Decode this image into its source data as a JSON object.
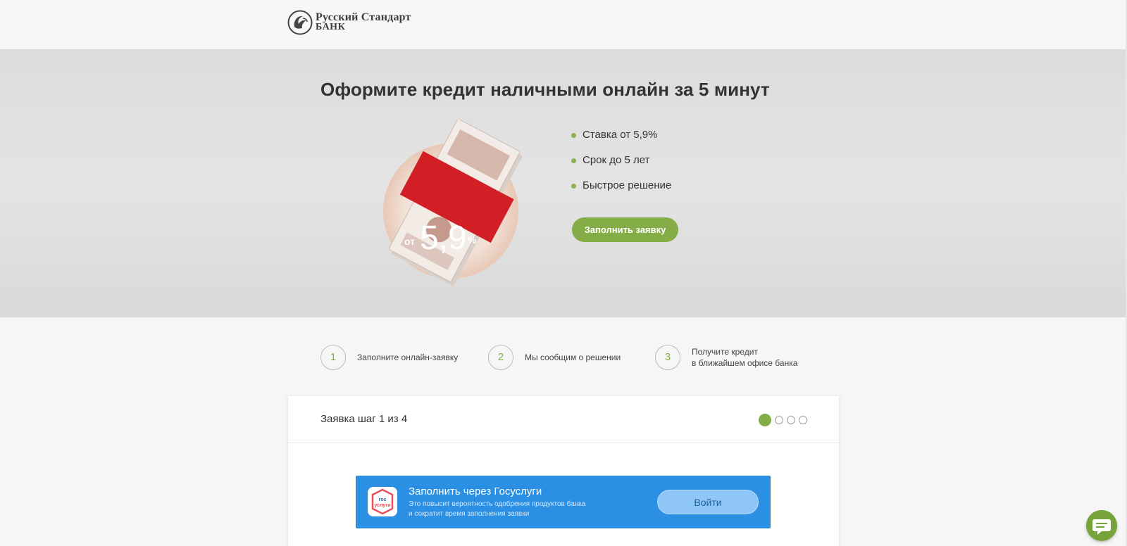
{
  "header": {
    "logo": {
      "line1": "Русский Стандарт",
      "line2": "БАНК"
    }
  },
  "hero": {
    "title": "Оформите кредит наличными онлайн за 5 минут",
    "art": {
      "rate_prefix": "от",
      "rate_value": "5,9",
      "rate_unit": "%"
    },
    "features": [
      "Ставка от 5,9%",
      "Срок до 5 лет",
      "Быстрое решение"
    ],
    "cta_label": "Заполнить заявку",
    "accent_color": "#84ad48"
  },
  "steps": [
    {
      "number": "1",
      "text_line1": "Заполните онлайн-заявку",
      "text_line2": ""
    },
    {
      "number": "2",
      "text_line1": "Мы сообщим о решении",
      "text_line2": ""
    },
    {
      "number": "3",
      "text_line1": "Получите кредит",
      "text_line2": "в ближайшем офисе банка"
    }
  ],
  "application": {
    "title": "Заявка шаг 1 из 4",
    "current_step": 1,
    "total_steps": 4,
    "gosuslugi": {
      "logo_line1": "гос",
      "logo_line2": "услуги",
      "title": "Заполнить через Госуслуги",
      "subtitle_line1": "Это повысит вероятность одобрения продуктов банка",
      "subtitle_line2": "и сократит время заполнения заявки",
      "button_label": "Войти",
      "color": "#2b8fe3"
    }
  },
  "icons": {
    "chat": "chat-bubble-icon",
    "logo": "bank-logo-icon",
    "gosuslugi": "gosuslugi-logo-icon"
  }
}
